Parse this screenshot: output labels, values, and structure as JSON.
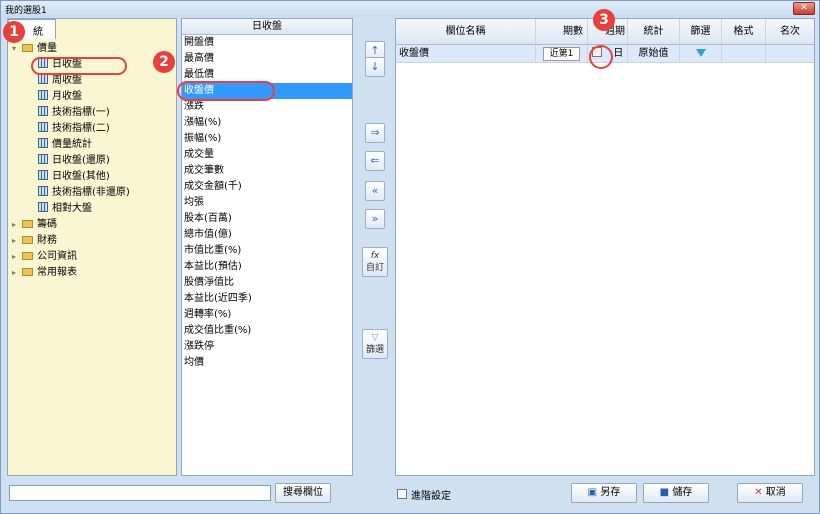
{
  "window": {
    "title": "我的選股1",
    "close_label": "✕"
  },
  "left_tab": {
    "label": "統"
  },
  "tree": {
    "price_folder": "價量",
    "items": [
      "日收盤",
      "周收盤",
      "月收盤",
      "技術指標(一)",
      "技術指標(二)",
      "價量統計",
      "日收盤(還原)",
      "日收盤(其他)",
      "技術指標(非還原)",
      "相對大盤"
    ],
    "folders": [
      "籌碼",
      "財務",
      "公司資訊",
      "常用報表"
    ]
  },
  "middle_list": {
    "header": "日收盤",
    "items": [
      "開盤價",
      "最高價",
      "最低價",
      "收盤價",
      "漲跌",
      "漲幅(%)",
      "振幅(%)",
      "成交量",
      "成交筆數",
      "成交金額(千)",
      "均張",
      "股本(百萬)",
      "總市值(億)",
      "市值比重(%)",
      "本益比(預估)",
      "股價淨值比",
      "本益比(近四季)",
      "週轉率(%)",
      "成交值比重(%)",
      "漲跌停",
      "均價"
    ],
    "selected_index": 3
  },
  "center_buttons": {
    "up": "↑",
    "down": "↓",
    "add": "⇒",
    "remove": "⇐",
    "remove_all": "«",
    "add_all": "»",
    "custom_symbol": "fx",
    "custom_label": "自訂",
    "filter_label": "篩選"
  },
  "right_table": {
    "headers": [
      "欄位名稱",
      "期數",
      "週期",
      "統計",
      "篩選",
      "格式",
      "名次"
    ],
    "rows": [
      {
        "field": "收盤價",
        "periods": "近第1",
        "cycle": "日",
        "stat": "原始值"
      }
    ]
  },
  "bottom": {
    "search_placeholder": "",
    "search_button": "搜尋欄位",
    "advanced_label": "進階設定",
    "save_as_label": "另存",
    "save_label": "儲存",
    "cancel_label": "取消"
  },
  "callouts": [
    "1",
    "2",
    "3"
  ],
  "colors": {
    "highlight": "#3399ff",
    "callout": "#e8403c",
    "tree_bg": "#fbf6d2"
  }
}
